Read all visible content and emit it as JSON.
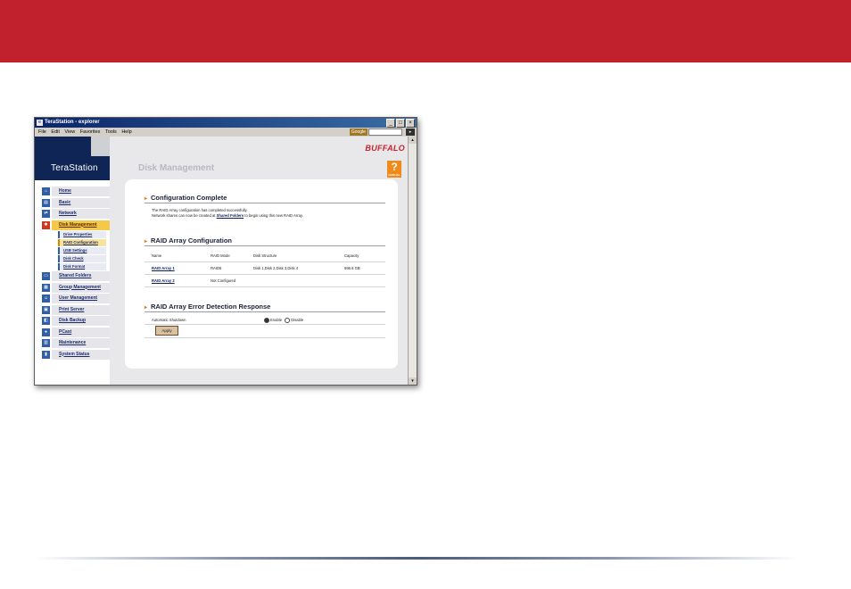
{
  "window": {
    "title": "TeraStation - explorer",
    "menu": [
      "File",
      "Edit",
      "View",
      "Favorites",
      "Tools",
      "Help"
    ],
    "google_label": "Google"
  },
  "brand": {
    "tera": "Tera",
    "station": "Station",
    "logo": "BUFFALO"
  },
  "header": {
    "page_title": "Disk Management",
    "help_glyph": "?",
    "help_caption": "MANUAL"
  },
  "sidebar": {
    "items": [
      {
        "label": "Home"
      },
      {
        "label": "Basic"
      },
      {
        "label": "Network"
      },
      {
        "label": "Disk Management"
      },
      {
        "label": "Shared Folders"
      },
      {
        "label": "Group Management"
      },
      {
        "label": "User Management"
      },
      {
        "label": "Print Server"
      },
      {
        "label": "Disk Backup"
      },
      {
        "label": "PCast"
      },
      {
        "label": "Maintenance"
      },
      {
        "label": "System Status"
      }
    ],
    "subitems": [
      {
        "label": "Drive Properties"
      },
      {
        "label": "RAID Configuration"
      },
      {
        "label": "USB Settings"
      },
      {
        "label": "Disk Check"
      },
      {
        "label": "Disk Format"
      }
    ]
  },
  "config_complete": {
    "title": "Configuration Complete",
    "line1": "The RAID Array configuration has completed successfully.",
    "line2_pre": "Network shares can now be created at",
    "line2_link": "Shared Folders",
    "line2_post": "to begin using this new RAID Array."
  },
  "raid_config": {
    "title": "RAID Array Configuration",
    "headers": [
      "Name",
      "RAID Mode",
      "Disk Structure",
      "Capacity"
    ],
    "rows": [
      {
        "name": "RAID Array 1",
        "mode": "RAID5",
        "structure": "Disk 1,Disk 2,Disk 3,Disk 4",
        "capacity": "696.6 GB"
      },
      {
        "name": "RAID Array 2",
        "mode": "Not Configured",
        "structure": "",
        "capacity": ""
      }
    ]
  },
  "error_detection": {
    "title": "RAID Array Error Detection Response",
    "label": "Automatic Shutdown",
    "option_enable": "Enable",
    "option_disable": "Disable",
    "apply_label": "Apply"
  }
}
